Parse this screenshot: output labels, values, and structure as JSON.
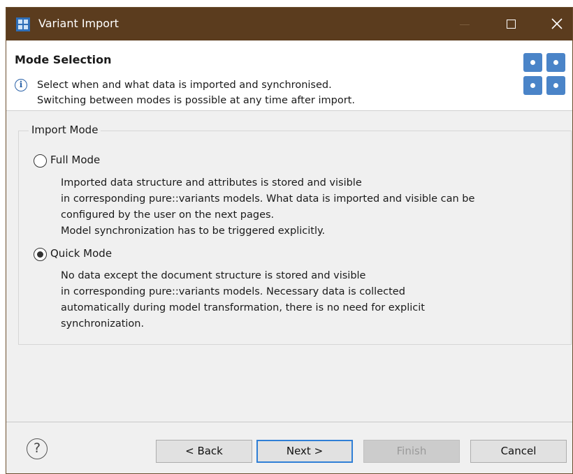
{
  "window": {
    "title": "Variant Import"
  },
  "header": {
    "title": "Mode Selection",
    "info_line1": "Select when and what data is imported and synchronised.",
    "info_line2": "Switching between modes is possible at any time after import."
  },
  "import_mode": {
    "group_label": "Import Mode",
    "selected": "quick",
    "options": [
      {
        "label": "Full Mode",
        "checked": false,
        "description": [
          "Imported data structure and attributes is stored and visible",
          "in corresponding pure::variants models. What data is imported and visible can be",
          "configured by the user on the next pages.",
          "Model synchronization has to be triggered explicitly."
        ]
      },
      {
        "label": "Quick Mode",
        "checked": true,
        "description": [
          "No data except the document structure is stored and visible",
          "in corresponding pure::variants models. Necessary data is collected",
          "automatically during model transformation, there is no need for explicit",
          "synchronization."
        ]
      }
    ]
  },
  "footer": {
    "help_glyph": "?",
    "back_label": "< Back",
    "next_label": "Next >",
    "finish_label": "Finish",
    "cancel_label": "Cancel",
    "finish_enabled": false
  },
  "colors": {
    "titlebar": "#5b3c1e",
    "accent": "#2f7fd6",
    "logo": "#4a84c8"
  },
  "icons": {
    "app": "app-grid-icon",
    "info": "info-icon",
    "help": "help-icon",
    "banner": "banner-logo-icon"
  }
}
